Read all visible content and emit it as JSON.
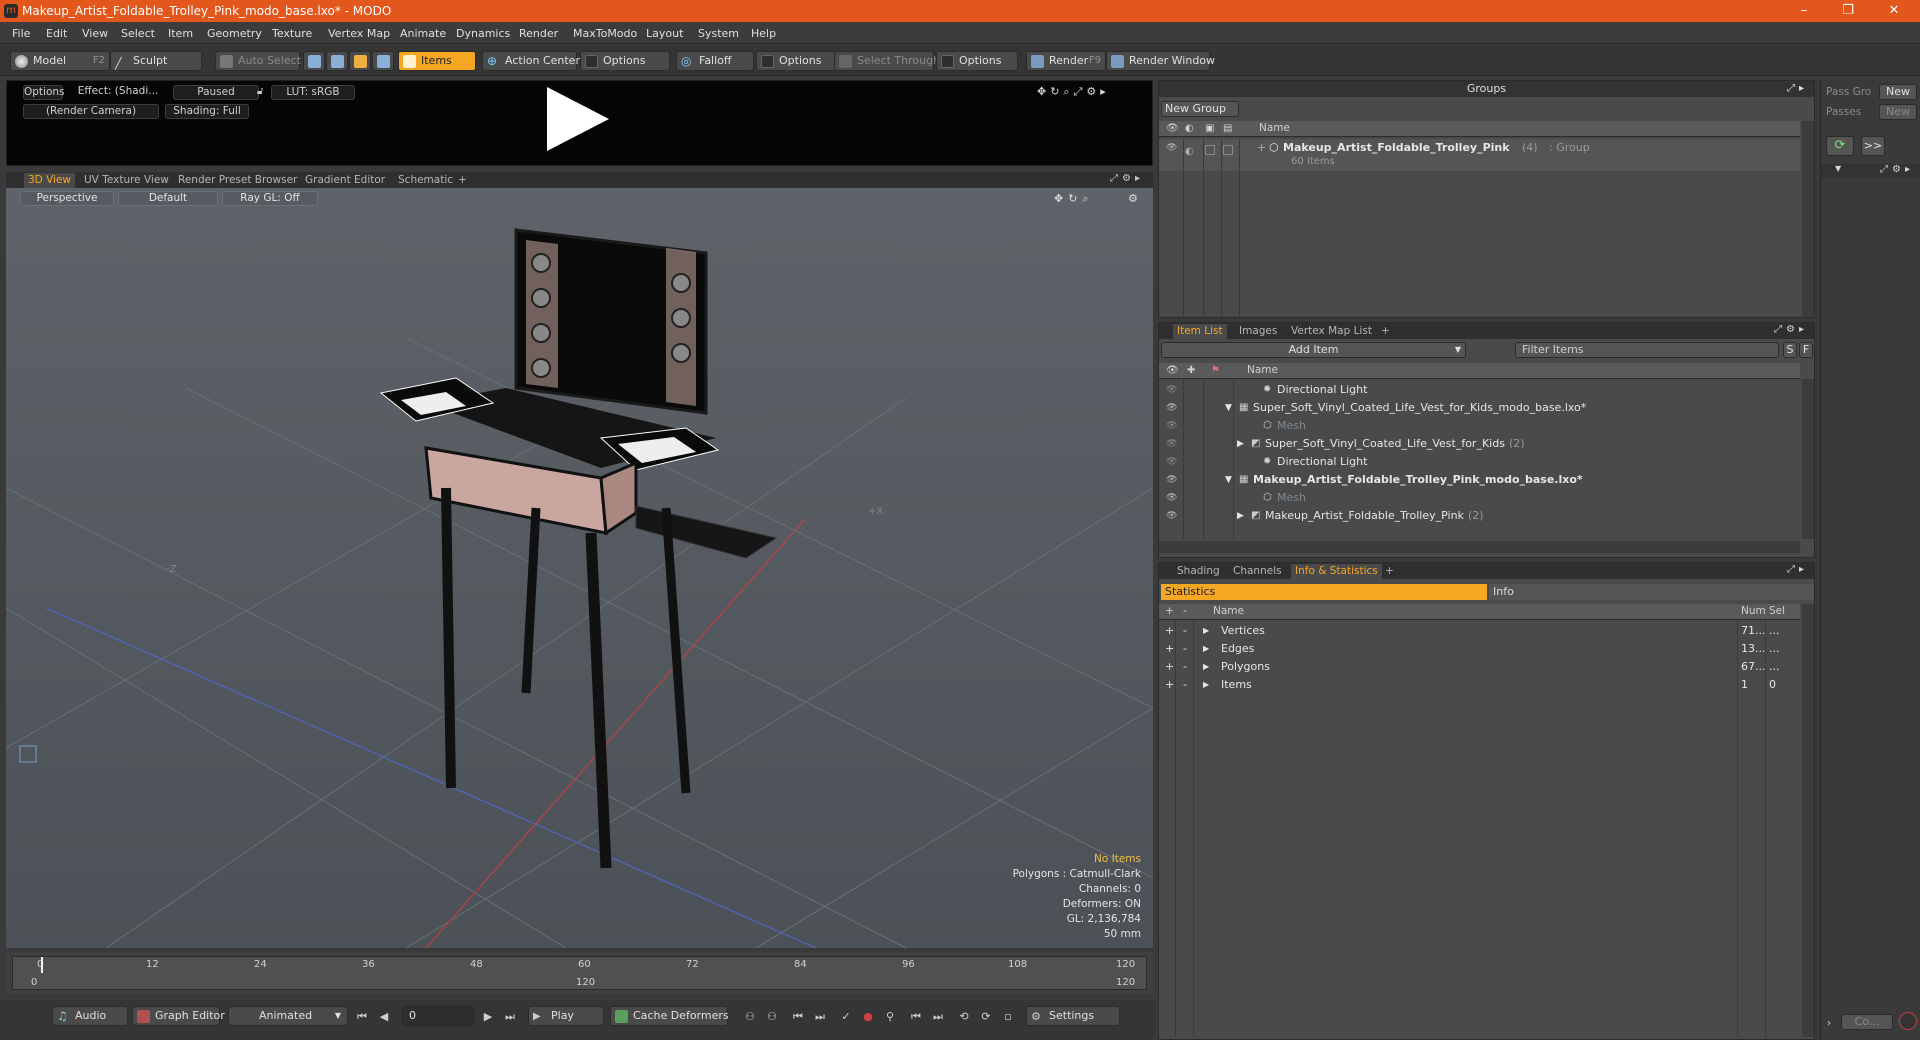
{
  "window": {
    "title": "Makeup_Artist_Foldable_Trolley_Pink_modo_base.lxo* - MODO",
    "minimize": "–",
    "maximize": "❐",
    "close": "✕"
  },
  "menu": [
    "File",
    "Edit",
    "View",
    "Select",
    "Item",
    "Geometry",
    "Texture",
    "Vertex Map",
    "Animate",
    "Dynamics",
    "Render",
    "MaxToModo",
    "Layout",
    "System",
    "Help"
  ],
  "toolbar": {
    "model": "Model",
    "model_key": "F2",
    "sculpt": "Sculpt",
    "auto_select": "Auto Select",
    "items": "Items",
    "action_center": "Action Center",
    "options1": "Options",
    "falloff": "Falloff",
    "options2": "Options",
    "select_through": "Select Through",
    "options3": "Options",
    "render": "Render",
    "render_key": "F9",
    "render_window": "Render Window"
  },
  "preview": {
    "options": "Options",
    "effect": "Effect: (Shadi...",
    "paused": "Paused",
    "lut": "LUT: sRGB",
    "camera": "(Render Camera)",
    "shading": "Shading: Full"
  },
  "view_tabs": [
    "3D View",
    "UV Texture View",
    "Render Preset Browser",
    "Gradient Editor",
    "Schematic",
    "+"
  ],
  "viewport": {
    "perspective": "Perspective",
    "default": "Default",
    "raygl": "Ray GL: Off",
    "axis_x": "+X",
    "axis_z": "-Z",
    "info": {
      "no_items": "No Items",
      "polygons": "Polygons : Catmull-Clark",
      "channels": "Channels: 0",
      "deformers": "Deformers: ON",
      "gl": "GL: 2,136,784",
      "lens": "50 mm"
    }
  },
  "timeline": {
    "ticks": [
      "0",
      "12",
      "24",
      "36",
      "48",
      "60",
      "72",
      "84",
      "96",
      "108",
      "120"
    ],
    "start": "0",
    "mid": "120",
    "end": "120"
  },
  "bottom": {
    "audio": "Audio",
    "graph_editor": "Graph Editor",
    "animated": "Animated",
    "frame": "0",
    "play": "Play",
    "cache": "Cache Deformers",
    "settings": "Settings"
  },
  "groups": {
    "title": "Groups",
    "new_group": "New Group",
    "col_name": "Name",
    "item": {
      "name": "Makeup_Artist_Foldable_Trolley_Pink",
      "count": "(4)",
      "type": ": Group",
      "sub": "60 Items"
    }
  },
  "pass": {
    "pass_label": "Pass Gro",
    "passes_label": "Passes",
    "new1": "New",
    "new2": "New",
    "expand": ">>",
    "co": "Co..."
  },
  "itemlist": {
    "tabs": [
      "Item List",
      "Images",
      "Vertex Map List",
      "+"
    ],
    "add_item": "Add Item",
    "filter": "Filter Items",
    "s": "S",
    "f": "F",
    "col_name": "Name",
    "rows": [
      {
        "label": "Directional Light",
        "indent": 3,
        "dim": false,
        "bold": false
      },
      {
        "label": "Super_Soft_Vinyl_Coated_Life_Vest_for_Kids_modo_base.lxo*",
        "indent": 1,
        "dim": false,
        "bold": false
      },
      {
        "label": "Mesh",
        "indent": 3,
        "dim": true,
        "bold": false
      },
      {
        "label": "Super_Soft_Vinyl_Coated_Life_Vest_for_Kids",
        "count": "(2)",
        "indent": 2,
        "dim": false,
        "bold": false
      },
      {
        "label": "Directional Light",
        "indent": 3,
        "dim": false,
        "bold": false
      },
      {
        "label": "Makeup_Artist_Foldable_Trolley_Pink_modo_base.lxo*",
        "indent": 1,
        "dim": false,
        "bold": true
      },
      {
        "label": "Mesh",
        "indent": 3,
        "dim": true,
        "bold": false
      },
      {
        "label": "Makeup_Artist_Foldable_Trolley_Pink",
        "count": "(2)",
        "indent": 2,
        "dim": false,
        "bold": false
      }
    ]
  },
  "stats": {
    "tabs": [
      "Shading",
      "Channels",
      "Info & Statistics",
      "+"
    ],
    "statistics": "Statistics",
    "info": "Info",
    "cols": {
      "plus": "+",
      "minus": "-",
      "name": "Name",
      "num": "Num",
      "sel": "Sel"
    },
    "rows": [
      {
        "name": "Vertices",
        "num": "71...",
        "sel": "..."
      },
      {
        "name": "Edges",
        "num": "13...",
        "sel": "..."
      },
      {
        "name": "Polygons",
        "num": "67...",
        "sel": "..."
      },
      {
        "name": "Items",
        "num": "1",
        "sel": "0"
      }
    ]
  },
  "colors": {
    "accent": "#f5a623",
    "titlebar": "#e3561c"
  }
}
